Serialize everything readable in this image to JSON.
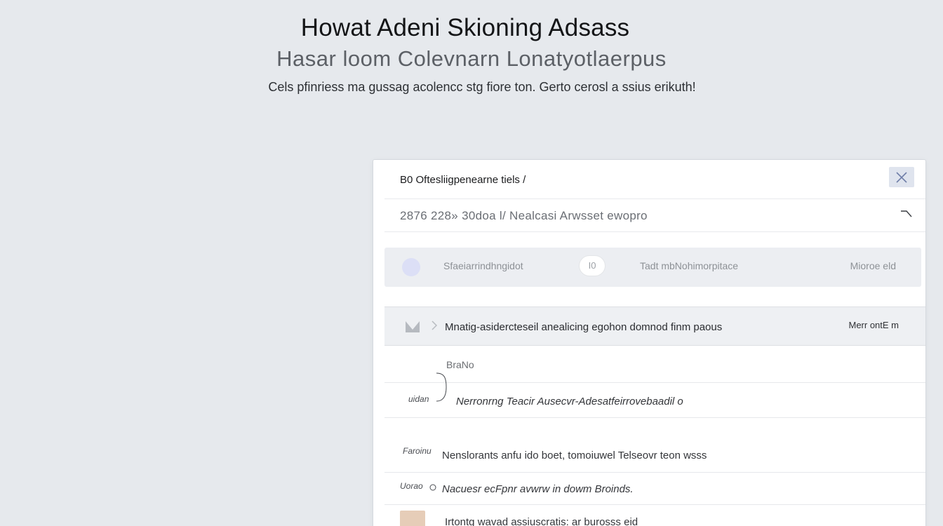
{
  "hero": {
    "title": "Howat Adeni Skioning Adsass",
    "subtitle": "Hasar loom Colevnarn Lonatyotlaerpus",
    "description": "Cels pfinriess ma gussag acolencc stg fiore ton. Gerto cerosl a ssius erikuth!"
  },
  "panel": {
    "title": "B0 Oftesliigpenearne tiels /",
    "search_text": "2876 228» 30doa l/ Nealcasi Arwsset ewopro",
    "toolbar": {
      "item1": "Sfaeiarrindhngidot",
      "item2_badge": "I0",
      "item3": "Tadt mbNohimorpitace",
      "item4": "Mioroe eld"
    },
    "selected_row": {
      "text": "Mnatig-asidercteseil anealicing egohon domnod finm paous",
      "meta": "Merr ontE m"
    },
    "rows": [
      {
        "label": "BraNo",
        "text": ""
      },
      {
        "label": "uidan",
        "text": "Nerronrng Teacir Ausecvr-Adesatfeirrovebaadil o"
      },
      {
        "label": "Faroinu",
        "text": "Nenslorants anfu ido boet, tomoiuwel Telseovr teon wsss"
      },
      {
        "label": "Uorao",
        "text": "Nacuesr ecFpnr avwrw in dowm Broinds."
      },
      {
        "label": "",
        "text": "Irtontg wavad assiuscratis: ar burosss eid"
      }
    ]
  },
  "colors": {
    "accent": "#e3a52a",
    "close_bg": "#dfe4ee"
  }
}
